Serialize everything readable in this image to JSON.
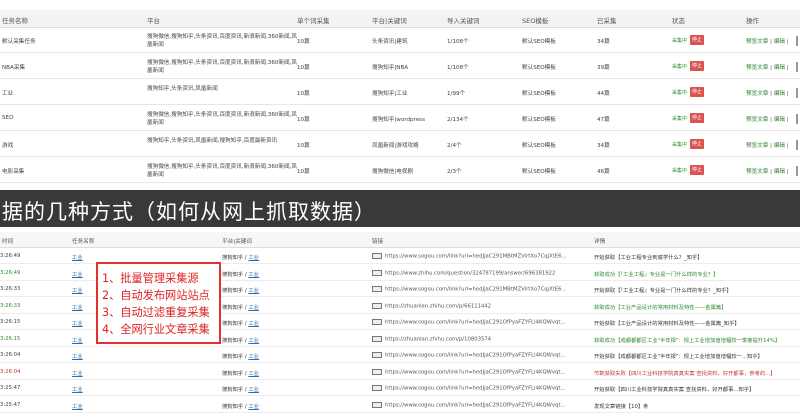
{
  "task_table": {
    "headers": [
      "任务名称",
      "平台",
      "单个词采集",
      "平台|关键词",
      "导入关键词",
      "SEO模板",
      "已采集",
      "状态",
      "操作"
    ],
    "rows": [
      {
        "name": "默认采集任务",
        "platform": "搜狗微信,搜狗知乎,头条资讯,百度资讯,新浪新闻,360新闻,凤凰新闻",
        "per_word": "10篇",
        "plat_kw": "头条资讯|建筑",
        "imported": "1/108个",
        "seo": "默认SEO模板",
        "collected": "34篇",
        "status_on": "采集中",
        "status_stop": "停止",
        "ops": "预览文章 | 编辑 |"
      },
      {
        "name": "NBA采集",
        "platform": "搜狗微信,搜狗知乎,头条资讯,百度资讯,新浪新闻,360新闻,凤凰新闻",
        "per_word": "10篇",
        "plat_kw": "搜狗知乎|NBA",
        "imported": "1/108个",
        "seo": "默认SEO模板",
        "collected": "39篇",
        "status_on": "采集中",
        "status_stop": "停止",
        "ops": "预览文章 | 编辑 |"
      },
      {
        "name": "工业",
        "platform": "搜狗知乎,头条资讯,凤凰新闻",
        "per_word": "10篇",
        "plat_kw": "搜狗知乎|工业",
        "imported": "1/99个",
        "seo": "默认SEO模板",
        "collected": "44篇",
        "status_on": "采集中",
        "status_stop": "停止",
        "ops": "预览文章 | 编辑 |"
      },
      {
        "name": "SEO",
        "platform": "搜狗微信,搜狗知乎,头条资讯,百度资讯,新浪新闻,360新闻,凤凰新闻",
        "per_word": "10篇",
        "plat_kw": "搜狗知乎|wordpress",
        "imported": "2/134个",
        "seo": "默认SEO模板",
        "collected": "47篇",
        "status_on": "采集中",
        "status_stop": "停止",
        "ops": "预览文章 | 编辑 |"
      },
      {
        "name": "游戏",
        "platform": "搜狗知乎,头条资讯,凤凰新闻,搜狗知乎,百度最新资讯",
        "per_word": "10篇",
        "plat_kw": "凤凰新闻|游戏攻略",
        "imported": "2/4个",
        "seo": "默认SEO模板",
        "collected": "34篇",
        "status_on": "采集中",
        "status_stop": "停止",
        "ops": "预览文章 | 编辑 |"
      },
      {
        "name": "电影采集",
        "platform": "搜狗微信,搜狗知乎,头条资讯,百度资讯,新浪新闻,360新闻,凤凰新闻",
        "per_word": "10篇",
        "plat_kw": "搜狗微信|电视剧",
        "imported": "2/3个",
        "seo": "默认SEO模板",
        "collected": "46篇",
        "status_on": "采集中",
        "status_stop": "停止",
        "ops": "预览文章 | 编辑 |"
      }
    ]
  },
  "title_band": {
    "text": "据的几种方式（如何从网上抓取数据）"
  },
  "article_table": {
    "headers": [
      "时间",
      "任务名称",
      "平台|关键词",
      "链接",
      "详情"
    ],
    "rows": [
      {
        "time": "3:26:49",
        "time_color": "normal",
        "task": "工业",
        "platform": "搜狗知乎 / ",
        "keyword": "工业",
        "link": "https://www.sogou.com/link?url=hedJjaC291MBtMZVirtXo7CqjXtE6...",
        "detail": "开始获取【工业工程专业到底学什么？_知乎】",
        "detail_color": "normal"
      },
      {
        "time": "3:26:49",
        "time_color": "green",
        "task": "工业",
        "platform": "搜狗知乎 / ",
        "keyword": "工业",
        "link": "https://www.zhihu.com/question/324787199/answer/696381922",
        "detail": "获取成功【『工业工程』专业是一门什么样的专业？】",
        "detail_color": "green"
      },
      {
        "time": "3:26:33",
        "time_color": "normal",
        "task": "工业",
        "platform": "搜狗知乎 / ",
        "keyword": "工业",
        "link": "https://www.sogou.com/link?url=hedJjaC291MBtMZVirtXo7CqjXtE6...",
        "detail": "开始获取【『工业工程』专业是一门什么样的专业？_知乎】",
        "detail_color": "normal"
      },
      {
        "time": "3:26:33",
        "time_color": "green",
        "task": "工业",
        "platform": "搜狗知乎 / ",
        "keyword": "工业",
        "link": "https://zhuanlan.zhihu.com/p/66111442",
        "detail": "获取成功【工业产品设计的常用材料及特性——金属篇】",
        "detail_color": "green"
      },
      {
        "time": "3:26:15",
        "time_color": "normal",
        "task": "工业",
        "platform": "搜狗知乎 / ",
        "keyword": "工业",
        "link": "https://www.sogou.com/link?url=hedJjaC291OfPyaFZYFLl4KQWvqt...",
        "detail": "开始获取【工业产品设计的常用材料及特性——金属篇_知乎】",
        "detail_color": "normal"
      },
      {
        "time": "3:26:15",
        "time_color": "green",
        "task": "工业",
        "platform": "搜狗知乎 / ",
        "keyword": "工业",
        "link": "https://zhuanlan.zhihu.com/p/10803574",
        "detail": "获取成功【成都都都区工业\"半年报\"：规上工业增加值增幅较一季度提升14%】",
        "detail_color": "green"
      },
      {
        "time": "3:26:04",
        "time_color": "normal",
        "task": "工业",
        "platform": "搜狗知乎 / ",
        "keyword": "工业",
        "link": "https://www.sogou.com/link?url=hedJjaC291OfPyaFZYFLl4KQWvqt...",
        "detail": "开始获取【成都都都区工业\"半年报\"：规上工业增加值增幅较一...知乎】",
        "detail_color": "normal"
      },
      {
        "time": "3:26:04",
        "time_color": "red",
        "task": "工业",
        "platform": "搜狗知乎 / ",
        "keyword": "工业",
        "link": "https://www.sogou.com/link?url=hedJjaC291OfPyaFZYFLl4KQWvqt...",
        "detail": "节数获取失败【四川工业科技学院真真实案 查找资料，好开都事，参考的...】",
        "detail_color": "red"
      },
      {
        "time": "3:25:47",
        "time_color": "normal",
        "task": "工业",
        "platform": "搜狗知乎 / ",
        "keyword": "工业",
        "link": "https://www.sogou.com/link?url=hedJjaC291OfPyaFZYFLl4KQWvqt...",
        "detail": "开始获取【四川工业科技学院真真实案 查找资料，好开都事...知乎】",
        "detail_color": "normal"
      },
      {
        "time": "3:25:47",
        "time_color": "normal",
        "task": "工业",
        "platform": "搜狗知乎 / ",
        "keyword": "工业",
        "link": "https://www.sogou.com/link?url=hedJjaC291OfPyaFZYFLl4KQWvqt...",
        "detail": "发现文章链接【10】条",
        "detail_color": "normal"
      }
    ]
  },
  "features": [
    "1、批量管理采集源",
    "2、自动发布网站站点",
    "3、自动过滤重复采集",
    "4、全网行业文章采集"
  ],
  "colors": {
    "accent_red": "#e02020",
    "success_green": "#2e8b2e",
    "stop_button": "#d9534f",
    "band_dark": "#282828"
  }
}
